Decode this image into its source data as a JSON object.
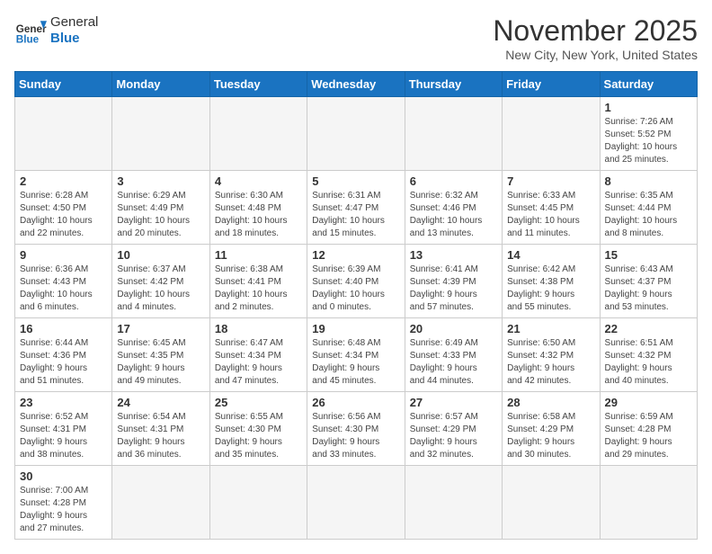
{
  "header": {
    "logo_general": "General",
    "logo_blue": "Blue",
    "month_title": "November 2025",
    "location": "New City, New York, United States"
  },
  "weekdays": [
    "Sunday",
    "Monday",
    "Tuesday",
    "Wednesday",
    "Thursday",
    "Friday",
    "Saturday"
  ],
  "weeks": [
    [
      {
        "day": "",
        "info": ""
      },
      {
        "day": "",
        "info": ""
      },
      {
        "day": "",
        "info": ""
      },
      {
        "day": "",
        "info": ""
      },
      {
        "day": "",
        "info": ""
      },
      {
        "day": "",
        "info": ""
      },
      {
        "day": "1",
        "info": "Sunrise: 7:26 AM\nSunset: 5:52 PM\nDaylight: 10 hours\nand 25 minutes."
      }
    ],
    [
      {
        "day": "2",
        "info": "Sunrise: 6:28 AM\nSunset: 4:50 PM\nDaylight: 10 hours\nand 22 minutes."
      },
      {
        "day": "3",
        "info": "Sunrise: 6:29 AM\nSunset: 4:49 PM\nDaylight: 10 hours\nand 20 minutes."
      },
      {
        "day": "4",
        "info": "Sunrise: 6:30 AM\nSunset: 4:48 PM\nDaylight: 10 hours\nand 18 minutes."
      },
      {
        "day": "5",
        "info": "Sunrise: 6:31 AM\nSunset: 4:47 PM\nDaylight: 10 hours\nand 15 minutes."
      },
      {
        "day": "6",
        "info": "Sunrise: 6:32 AM\nSunset: 4:46 PM\nDaylight: 10 hours\nand 13 minutes."
      },
      {
        "day": "7",
        "info": "Sunrise: 6:33 AM\nSunset: 4:45 PM\nDaylight: 10 hours\nand 11 minutes."
      },
      {
        "day": "8",
        "info": "Sunrise: 6:35 AM\nSunset: 4:44 PM\nDaylight: 10 hours\nand 8 minutes."
      }
    ],
    [
      {
        "day": "9",
        "info": "Sunrise: 6:36 AM\nSunset: 4:43 PM\nDaylight: 10 hours\nand 6 minutes."
      },
      {
        "day": "10",
        "info": "Sunrise: 6:37 AM\nSunset: 4:42 PM\nDaylight: 10 hours\nand 4 minutes."
      },
      {
        "day": "11",
        "info": "Sunrise: 6:38 AM\nSunset: 4:41 PM\nDaylight: 10 hours\nand 2 minutes."
      },
      {
        "day": "12",
        "info": "Sunrise: 6:39 AM\nSunset: 4:40 PM\nDaylight: 10 hours\nand 0 minutes."
      },
      {
        "day": "13",
        "info": "Sunrise: 6:41 AM\nSunset: 4:39 PM\nDaylight: 9 hours\nand 57 minutes."
      },
      {
        "day": "14",
        "info": "Sunrise: 6:42 AM\nSunset: 4:38 PM\nDaylight: 9 hours\nand 55 minutes."
      },
      {
        "day": "15",
        "info": "Sunrise: 6:43 AM\nSunset: 4:37 PM\nDaylight: 9 hours\nand 53 minutes."
      }
    ],
    [
      {
        "day": "16",
        "info": "Sunrise: 6:44 AM\nSunset: 4:36 PM\nDaylight: 9 hours\nand 51 minutes."
      },
      {
        "day": "17",
        "info": "Sunrise: 6:45 AM\nSunset: 4:35 PM\nDaylight: 9 hours\nand 49 minutes."
      },
      {
        "day": "18",
        "info": "Sunrise: 6:47 AM\nSunset: 4:34 PM\nDaylight: 9 hours\nand 47 minutes."
      },
      {
        "day": "19",
        "info": "Sunrise: 6:48 AM\nSunset: 4:34 PM\nDaylight: 9 hours\nand 45 minutes."
      },
      {
        "day": "20",
        "info": "Sunrise: 6:49 AM\nSunset: 4:33 PM\nDaylight: 9 hours\nand 44 minutes."
      },
      {
        "day": "21",
        "info": "Sunrise: 6:50 AM\nSunset: 4:32 PM\nDaylight: 9 hours\nand 42 minutes."
      },
      {
        "day": "22",
        "info": "Sunrise: 6:51 AM\nSunset: 4:32 PM\nDaylight: 9 hours\nand 40 minutes."
      }
    ],
    [
      {
        "day": "23",
        "info": "Sunrise: 6:52 AM\nSunset: 4:31 PM\nDaylight: 9 hours\nand 38 minutes."
      },
      {
        "day": "24",
        "info": "Sunrise: 6:54 AM\nSunset: 4:31 PM\nDaylight: 9 hours\nand 36 minutes."
      },
      {
        "day": "25",
        "info": "Sunrise: 6:55 AM\nSunset: 4:30 PM\nDaylight: 9 hours\nand 35 minutes."
      },
      {
        "day": "26",
        "info": "Sunrise: 6:56 AM\nSunset: 4:30 PM\nDaylight: 9 hours\nand 33 minutes."
      },
      {
        "day": "27",
        "info": "Sunrise: 6:57 AM\nSunset: 4:29 PM\nDaylight: 9 hours\nand 32 minutes."
      },
      {
        "day": "28",
        "info": "Sunrise: 6:58 AM\nSunset: 4:29 PM\nDaylight: 9 hours\nand 30 minutes."
      },
      {
        "day": "29",
        "info": "Sunrise: 6:59 AM\nSunset: 4:28 PM\nDaylight: 9 hours\nand 29 minutes."
      }
    ],
    [
      {
        "day": "30",
        "info": "Sunrise: 7:00 AM\nSunset: 4:28 PM\nDaylight: 9 hours\nand 27 minutes."
      },
      {
        "day": "",
        "info": ""
      },
      {
        "day": "",
        "info": ""
      },
      {
        "day": "",
        "info": ""
      },
      {
        "day": "",
        "info": ""
      },
      {
        "day": "",
        "info": ""
      },
      {
        "day": "",
        "info": ""
      }
    ]
  ]
}
